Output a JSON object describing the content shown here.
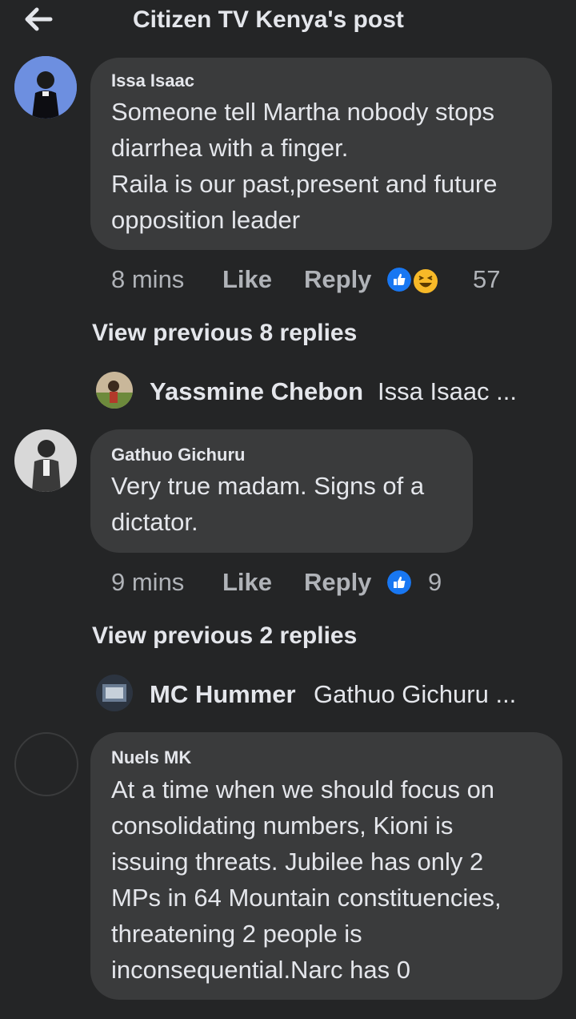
{
  "header": {
    "title": "Citizen TV Kenya's post",
    "back_icon": "arrow-left-icon"
  },
  "comments": [
    {
      "author": "Issa Isaac",
      "lines": [
        "Someone tell Martha nobody stops",
        "diarrhea with a finger.",
        "Raila is our past,present and future",
        "opposition leader"
      ],
      "time": "8 mins",
      "like": "Like",
      "reply": "Reply",
      "reactions": [
        "like",
        "haha"
      ],
      "reaction_count": "57"
    },
    {
      "author": "Gathuo Gichuru",
      "lines": [
        "Very true madam. Signs of a",
        "dictator."
      ],
      "time": "9 mins",
      "like": "Like",
      "reply": "Reply",
      "reactions": [
        "like"
      ],
      "reaction_count": "9"
    },
    {
      "author": "Nuels MK",
      "lines": [
        "At a time when we should focus on",
        "consolidating numbers, Kioni is",
        "issuing threats. Jubilee has only 2",
        "MPs in 64 Mountain constituencies,",
        "threatening 2 people is",
        "inconsequential.Narc has 0"
      ]
    }
  ],
  "replies": [
    {
      "view_previous": "View previous 8 replies",
      "name": "Yassmine Chebon",
      "snippet": "Issa Isaac ..."
    },
    {
      "view_previous": "View previous 2 replies",
      "name": "MC Hummer",
      "snippet": "Gathuo Gichuru ..."
    }
  ],
  "colors": {
    "background": "#242526",
    "bubble": "#3a3b3c",
    "like_blue": "#1877f2",
    "haha_yellow": "#f7b928"
  }
}
